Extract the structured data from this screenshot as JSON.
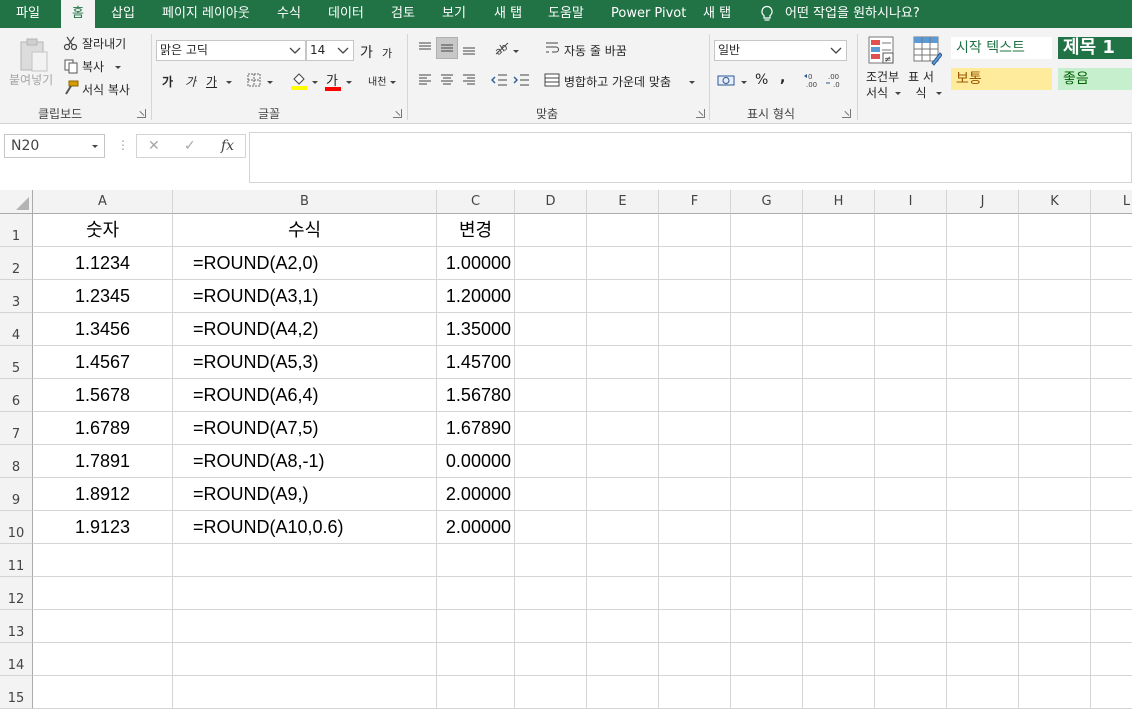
{
  "menu": {
    "tabs": [
      "파일",
      "홈",
      "삽입",
      "페이지 레이아웃",
      "수식",
      "데이터",
      "검토",
      "보기",
      "새 탭",
      "도움말",
      "Power Pivot",
      "새 탭"
    ],
    "tell_me": "어떤 작업을 원하시나요?"
  },
  "ribbon": {
    "clipboard": {
      "paste": "붙여넣기",
      "cut": "잘라내기",
      "copy": "복사",
      "format_painter": "서식 복사",
      "label": "클립보드"
    },
    "font": {
      "name": "맑은 고딕",
      "size": "14",
      "grow": "가",
      "shrink": "가",
      "bold": "가",
      "italic": "가",
      "underline": "가",
      "font_color_glyph": "가",
      "phonetic": "내천",
      "label": "글꼴"
    },
    "alignment": {
      "wrap_text": "자동 줄 바꿈",
      "merge_center": "병합하고 가운데 맞춤",
      "label": "맞춤"
    },
    "number": {
      "format": "일반",
      "percent": "%",
      "comma": ",",
      "label": "표시 형식"
    },
    "styles": {
      "conditional": "조건부 서식",
      "table": "표 서식",
      "normal_text": "시작 텍스트",
      "heading1": "제목 1",
      "neutral": "보통",
      "good": "좋음"
    },
    "colors": {
      "accent": "#217346",
      "neutral_fill": "#ffeb9c",
      "good_fill": "#c6efce"
    }
  },
  "formula_bar": {
    "name_box": "N20",
    "cancel": "✕",
    "enter": "✓",
    "fx": "fx",
    "content": ""
  },
  "sheet": {
    "columns": [
      "A",
      "B",
      "C",
      "D",
      "E",
      "F",
      "G",
      "H",
      "I",
      "J",
      "K",
      "L"
    ],
    "rows": [
      "1",
      "2",
      "3",
      "4",
      "5",
      "6",
      "7",
      "8",
      "9",
      "10",
      "11",
      "12",
      "13",
      "14",
      "15"
    ],
    "headers": [
      "숫자",
      "수식",
      "변경"
    ],
    "data": [
      [
        "1.1234",
        "=ROUND(A2,0)",
        "1.00000"
      ],
      [
        "1.2345",
        "=ROUND(A3,1)",
        "1.20000"
      ],
      [
        "1.3456",
        "=ROUND(A4,2)",
        "1.35000"
      ],
      [
        "1.4567",
        "=ROUND(A5,3)",
        "1.45700"
      ],
      [
        "1.5678",
        "=ROUND(A6,4)",
        "1.56780"
      ],
      [
        "1.6789",
        "=ROUND(A7,5)",
        "1.67890"
      ],
      [
        "1.7891",
        "=ROUND(A8,-1)",
        "0.00000"
      ],
      [
        "1.8912",
        "=ROUND(A9,)",
        "2.00000"
      ],
      [
        "1.9123",
        "=ROUND(A10,0.6)",
        "2.00000"
      ]
    ]
  }
}
